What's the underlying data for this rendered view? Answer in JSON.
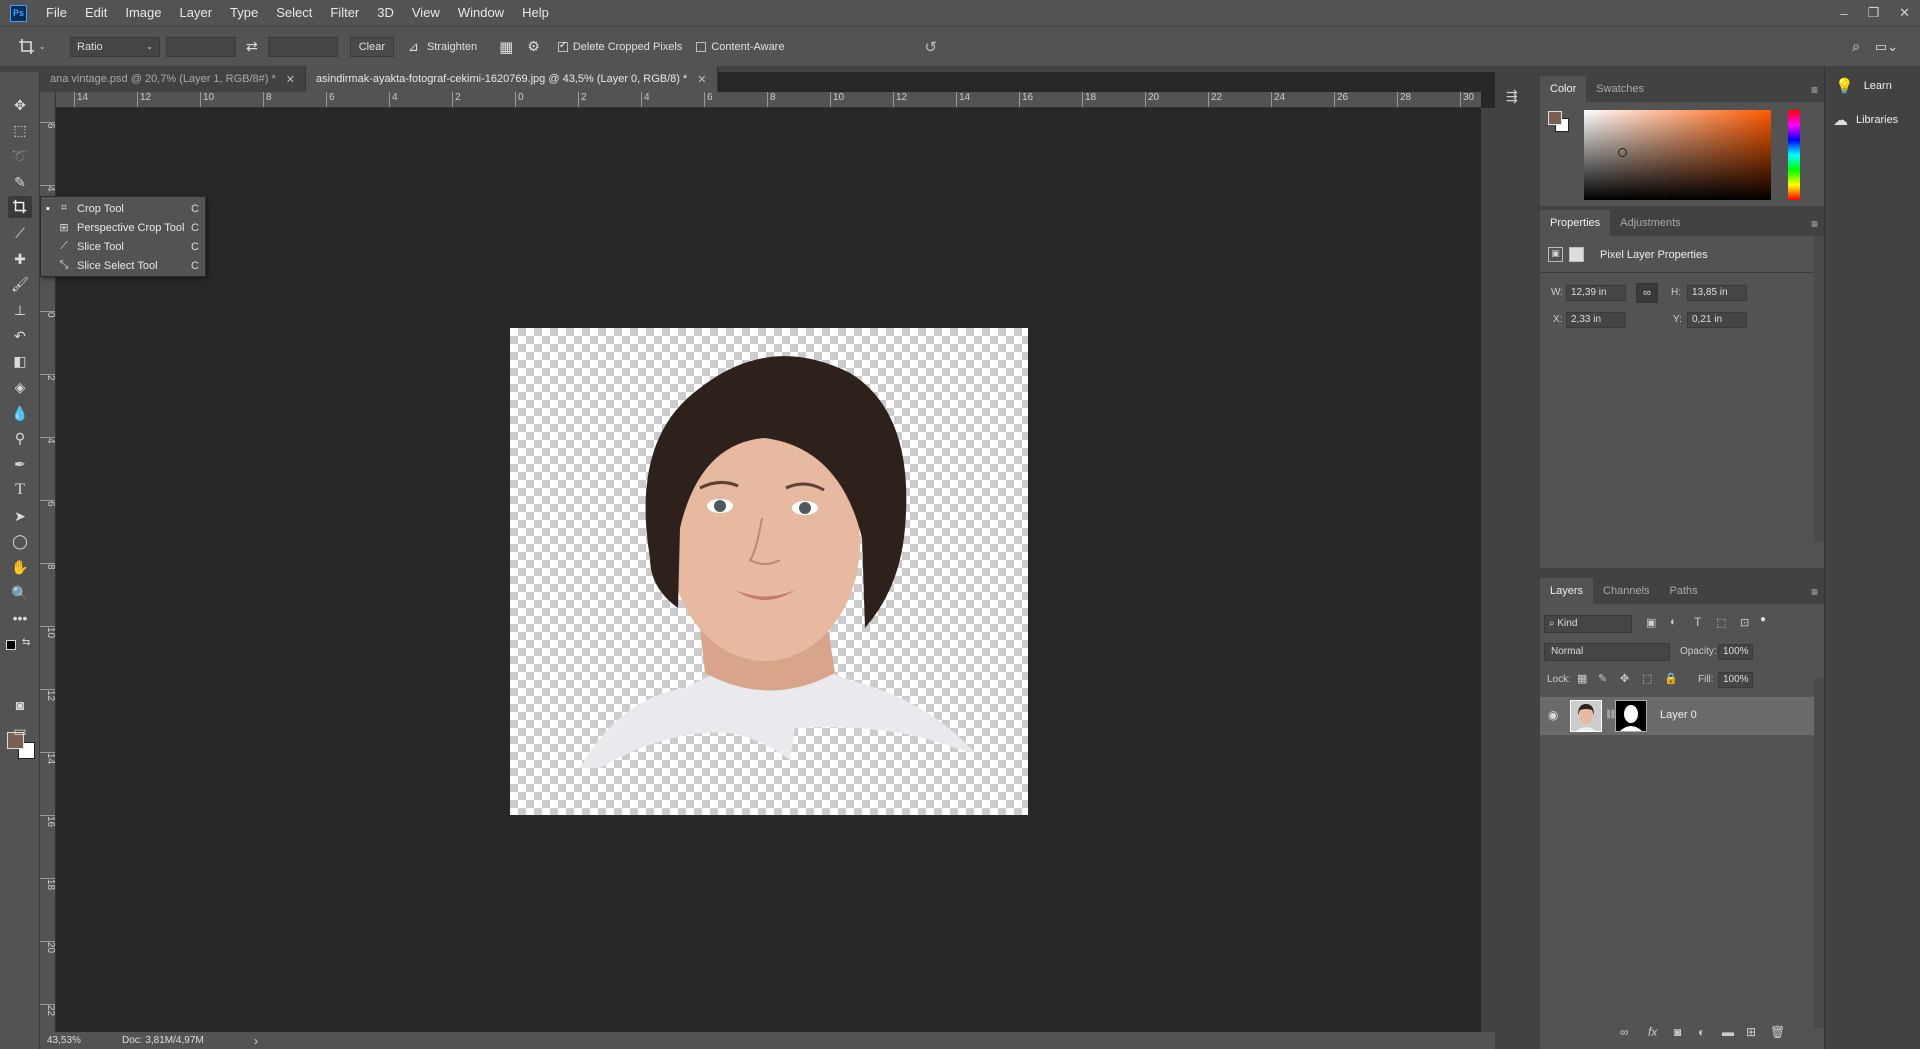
{
  "app": {
    "logo": "Ps"
  },
  "menu": [
    "File",
    "Edit",
    "Image",
    "Layer",
    "Type",
    "Select",
    "Filter",
    "3D",
    "View",
    "Window",
    "Help"
  ],
  "window_controls": {
    "minimize": "–",
    "restore": "❐",
    "close": "✕"
  },
  "options": {
    "ratio_label": "Ratio",
    "clear_label": "Clear",
    "straighten_label": "Straighten",
    "delete_cropped_label": "Delete Cropped Pixels",
    "delete_cropped_checked": true,
    "content_aware_label": "Content-Aware",
    "content_aware_checked": false
  },
  "tabs": [
    {
      "title": "ana vintage.psd @ 20,7% (Layer 1, RGB/8#) *",
      "close": "✕",
      "active": false
    },
    {
      "title": "asindirmak-ayakta-fotograf-cekimi-1620769.jpg @ 43,5% (Layer 0, RGB/8) *",
      "close": "✕",
      "active": true
    }
  ],
  "ruler": {
    "h_labels": [
      "14",
      "12",
      "10",
      "8",
      "6",
      "4",
      "2",
      "0",
      "2",
      "4",
      "6",
      "8",
      "10",
      "12",
      "14",
      "16",
      "18",
      "20",
      "22",
      "24",
      "26",
      "28",
      "30"
    ],
    "v_labels": [
      "6",
      "4",
      "2",
      "0",
      "2",
      "4",
      "6",
      "8",
      "10",
      "12",
      "14",
      "16",
      "18",
      "20",
      "22"
    ]
  },
  "flyout": [
    {
      "label": "Crop Tool",
      "key": "C",
      "icon": "crop-icon",
      "selected": true
    },
    {
      "label": "Perspective Crop Tool",
      "key": "C",
      "icon": "perspective-crop-icon",
      "selected": false
    },
    {
      "label": "Slice Tool",
      "key": "C",
      "icon": "slice-icon",
      "selected": false
    },
    {
      "label": "Slice Select Tool",
      "key": "C",
      "icon": "slice-select-icon",
      "selected": false
    }
  ],
  "status": {
    "zoom": "43,53%",
    "doc": "Doc: 3,81M/4,97M",
    "arrow": "›"
  },
  "color_panel": {
    "tabs": [
      "Color",
      "Swatches"
    ],
    "foreground": "#7a5f52",
    "background": "#ffffff",
    "hue": "#ff5a00"
  },
  "properties_panel": {
    "tabs": [
      "Properties",
      "Adjustments"
    ],
    "title": "Pixel Layer Properties",
    "w_label": "W:",
    "w": "12,39 in",
    "h_label": "H:",
    "h": "13,85 in",
    "x_label": "X:",
    "x": "2,33 in",
    "y_label": "Y:",
    "y": "0,21 in"
  },
  "layers_panel": {
    "tabs": [
      "Layers",
      "Channels",
      "Paths"
    ],
    "filter": "Kind",
    "blend_mode": "Normal",
    "opacity_label": "Opacity:",
    "opacity": "100%",
    "lock_label": "Lock:",
    "fill_label": "Fill:",
    "fill": "100%",
    "layers": [
      {
        "name": "Layer 0"
      }
    ]
  },
  "side_panels": [
    {
      "label": "Learn"
    },
    {
      "label": "Libraries"
    }
  ]
}
